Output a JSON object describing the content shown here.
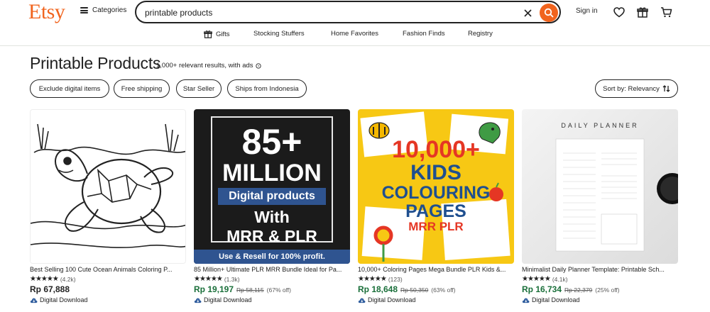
{
  "header": {
    "logo": "Etsy",
    "categories_label": "Categories",
    "search_value": "printable products",
    "signin_label": "Sign in",
    "accent": "#f1641e"
  },
  "nav": {
    "items": [
      {
        "label": "Gifts",
        "icon": "gift-icon"
      },
      {
        "label": "Stocking Stuffers"
      },
      {
        "label": "Home Favorites"
      },
      {
        "label": "Fashion Finds"
      },
      {
        "label": "Registry"
      }
    ]
  },
  "page": {
    "title": "Printable Products",
    "results": "1,000+ relevant results, with ads",
    "sort_label": "Sort by: Relevancy"
  },
  "filters": [
    "Exclude digital items",
    "Free shipping",
    "Star Seller",
    "Ships from Indonesia"
  ],
  "products": [
    {
      "title": "Best Selling 100 Cute Ocean Animals Coloring P...",
      "reviews": "(4.2k)",
      "price": "Rp 67,888",
      "original": "",
      "discount": "",
      "delivery": "Digital Download",
      "image": "turtle coloring page"
    },
    {
      "title": "85 Million+ Ultimate PLR MRR Bundle Ideal for Pa...",
      "reviews": "(1.3k)",
      "price": "Rp 19,197",
      "original": "Rp 58,115",
      "discount": "(67% off)",
      "delivery": "Digital Download",
      "image_text": {
        "line1": "85+",
        "line2": "MILLION",
        "line3": "Digital products",
        "line4": "With",
        "line5": "MRR & PLR",
        "line6": "Use & Resell for 100% profit."
      }
    },
    {
      "title": "10,000+ Coloring Pages Mega Bundle PLR Kids &...",
      "reviews": "(123)",
      "price": "Rp 18,648",
      "original": "Rp 50,350",
      "discount": "(63% off)",
      "delivery": "Digital Download",
      "image_text": {
        "line1": "10,000+",
        "line2": "KIDS",
        "line3": "COLOURING",
        "line4": "PAGES",
        "line5": "MRR PLR"
      }
    },
    {
      "title": "Minimalist Daily Planner Template: Printable Sch...",
      "reviews": "(4.1k)",
      "price": "Rp 16,734",
      "original": "Rp 22,379",
      "discount": "(25% off)",
      "delivery": "Digital Download",
      "image_text": {
        "line1": "DAILY PLANNER"
      }
    }
  ]
}
